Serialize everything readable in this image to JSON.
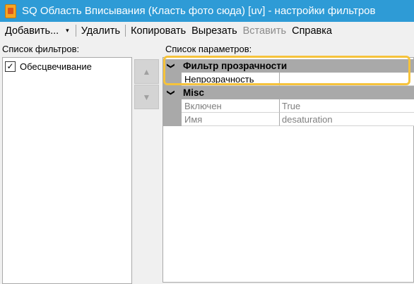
{
  "window": {
    "title": "SQ Область Вписывания (Класть фото сюда) [uv] - настройки фильтров"
  },
  "menu": {
    "add": "Добавить...",
    "add_dropdown": "▾",
    "delete": "Удалить",
    "copy": "Копировать",
    "cut": "Вырезать",
    "paste": "Вставить",
    "help": "Справка"
  },
  "filters": {
    "label": "Список фильтров:",
    "items": [
      {
        "label": "Обесцвечивание",
        "checked": true
      }
    ]
  },
  "buttons": {
    "up": "▲",
    "down": "▼"
  },
  "params": {
    "label": "Список параметров:",
    "categories": [
      {
        "name": "Фильтр прозрачности",
        "properties": [
          {
            "name": "Непрозрачность",
            "value": ""
          }
        ]
      },
      {
        "name": "Misc",
        "properties": [
          {
            "name": "Включен",
            "value": "True"
          },
          {
            "name": "Имя",
            "value": "desaturation"
          }
        ]
      }
    ]
  },
  "colors": {
    "titlebar": "#2e9bd6",
    "grid_line": "#a9a9a9",
    "highlight": "#f6c33b"
  }
}
